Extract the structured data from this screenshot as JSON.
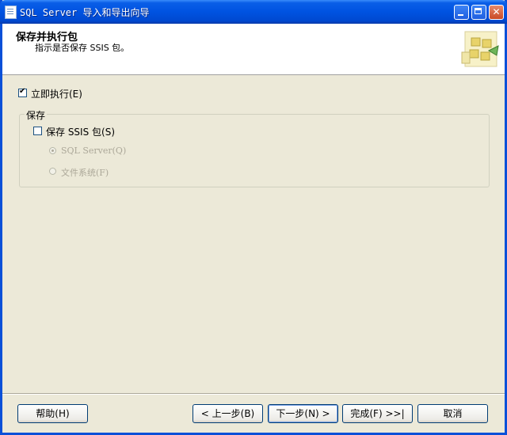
{
  "window": {
    "title": "SQL Server 导入和导出向导",
    "icon": "document-icon"
  },
  "header": {
    "title": "保存并执行包",
    "subtitle": "指示是否保存 SSIS 包。",
    "art_icon": "package-wizard-icon"
  },
  "options": {
    "execute_now": {
      "label": "立即执行(E)",
      "checked": true
    },
    "save_group": {
      "title": "保存",
      "save_ssis": {
        "label": "保存 SSIS 包(S)",
        "checked": false
      },
      "radio_sql_server": {
        "label": "SQL Server(Q)",
        "selected": true,
        "enabled": false
      },
      "radio_file_system": {
        "label": "文件系统(F)",
        "selected": false,
        "enabled": false
      }
    }
  },
  "buttons": {
    "help": "帮助(H)",
    "back": "< 上一步(B)",
    "next": "下一步(N) >",
    "finish": "完成(F) >>|",
    "cancel": "取消"
  },
  "colors": {
    "titlebar": "#0053e1",
    "dialog_bg": "#ece9d8",
    "header_bg": "#ffffff",
    "disabled_text": "#aca899"
  }
}
